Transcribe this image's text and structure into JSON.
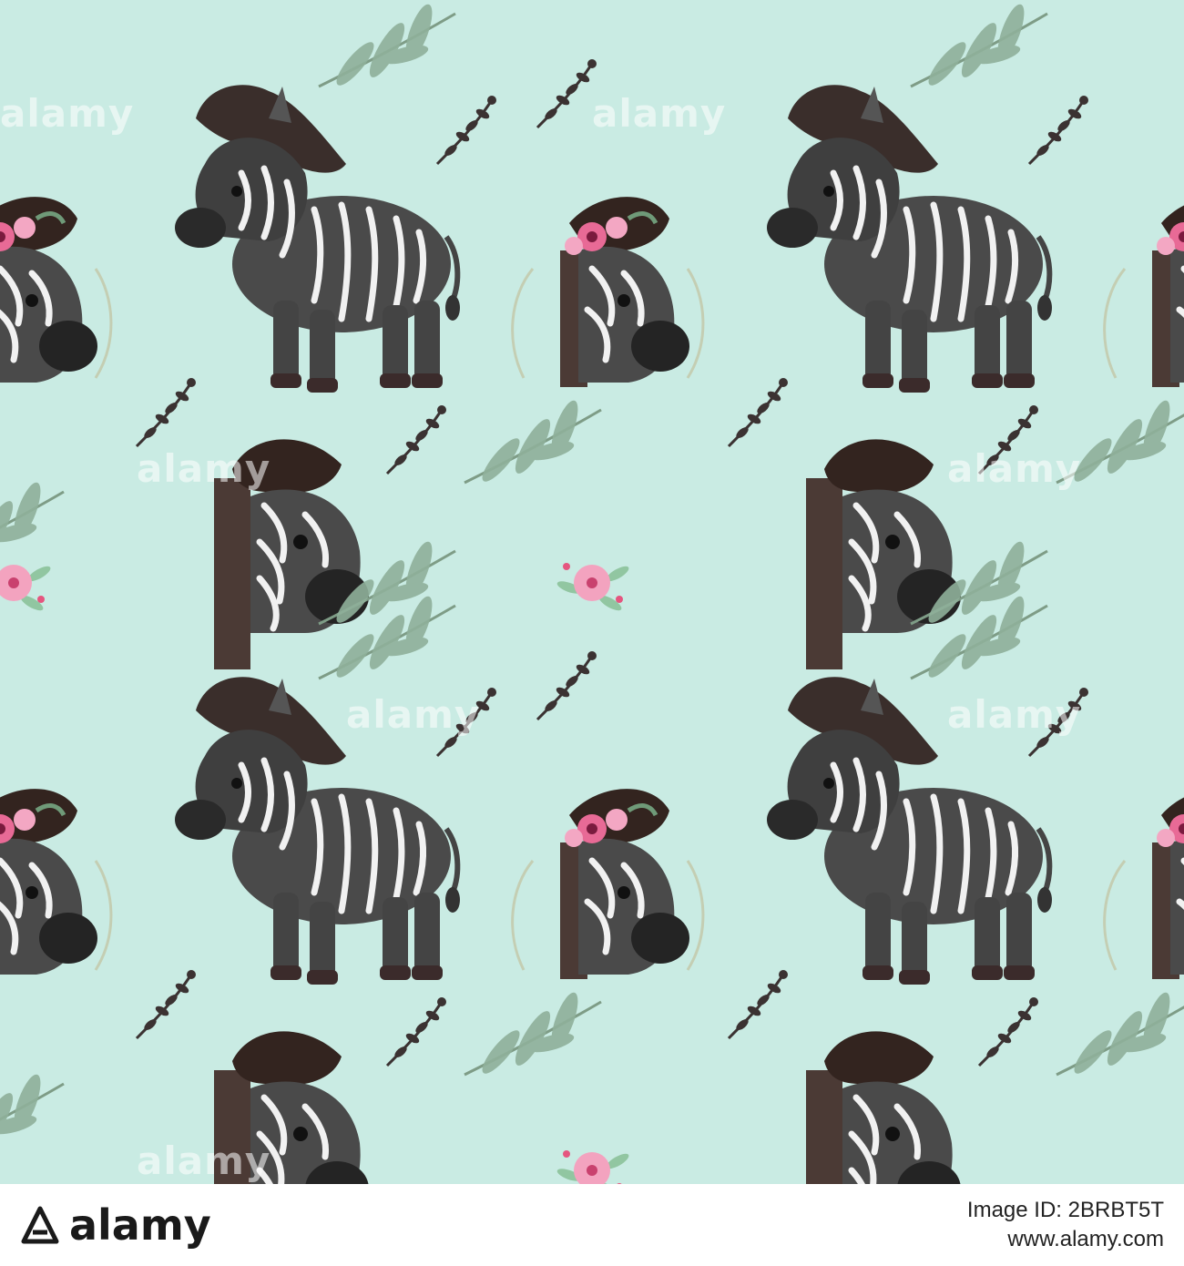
{
  "pattern": {
    "background_color": "#c9ebe3",
    "motifs": [
      "zebra-standing",
      "zebra-peeking",
      "zebra-with-flower-crown",
      "green-leaf-branch",
      "dark-berry-sprig",
      "pink-flower-bouquet"
    ]
  },
  "watermark": {
    "text": "alamy"
  },
  "footer": {
    "logo_text": "alamy",
    "image_id_line": "Image ID: 2BRBT5T",
    "site_line": "www.alamy.com"
  }
}
